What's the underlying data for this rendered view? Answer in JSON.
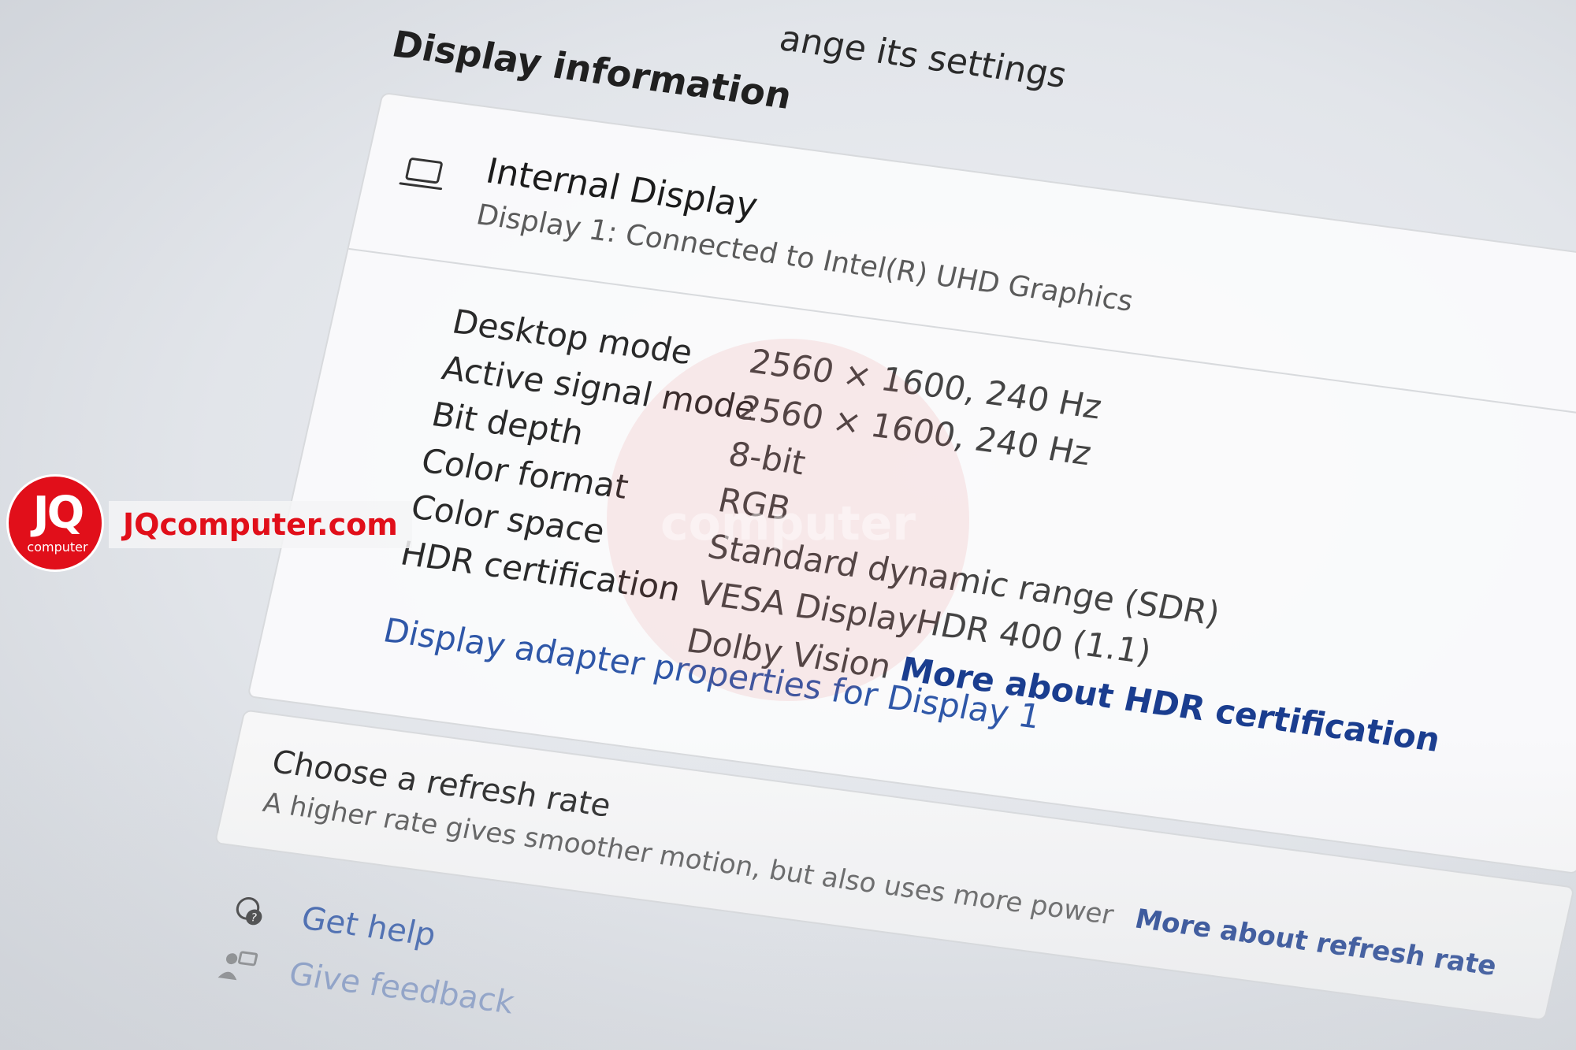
{
  "header": {
    "crumb_tail": "ange its settings",
    "section_title": "Display information"
  },
  "display": {
    "name": "Internal Display",
    "subtitle": "Display 1: Connected to Intel(R) UHD Graphics",
    "icon": "laptop-icon"
  },
  "info": {
    "desktop_mode": {
      "label": "Desktop mode",
      "value": "2560 × 1600, 240 Hz"
    },
    "active_signal_mode": {
      "label": "Active signal mode",
      "value": "2560 × 1600, 240 Hz"
    },
    "bit_depth": {
      "label": "Bit depth",
      "value": "8-bit"
    },
    "color_format": {
      "label": "Color format",
      "value": "RGB"
    },
    "color_space": {
      "label": "Color space",
      "value": "Standard dynamic range (SDR)"
    },
    "hdr_certification": {
      "label": "HDR certification",
      "value": "VESA DisplayHDR 400 (1.1)",
      "value2": "Dolby Vision",
      "link": "More about HDR certification"
    }
  },
  "adapter_link": "Display adapter properties for Display 1",
  "refresh": {
    "title": "Choose a refresh rate",
    "subtitle": "A higher rate gives smoother motion, but also uses more power",
    "link": "More about refresh rate"
  },
  "help": {
    "get_help": "Get help",
    "give_feedback": "Give feedback"
  },
  "watermark": {
    "text": "computer"
  },
  "logo": {
    "mark": "JQ",
    "small": "computer",
    "site": "JQcomputer.com",
    "color": "#e10f1a"
  }
}
